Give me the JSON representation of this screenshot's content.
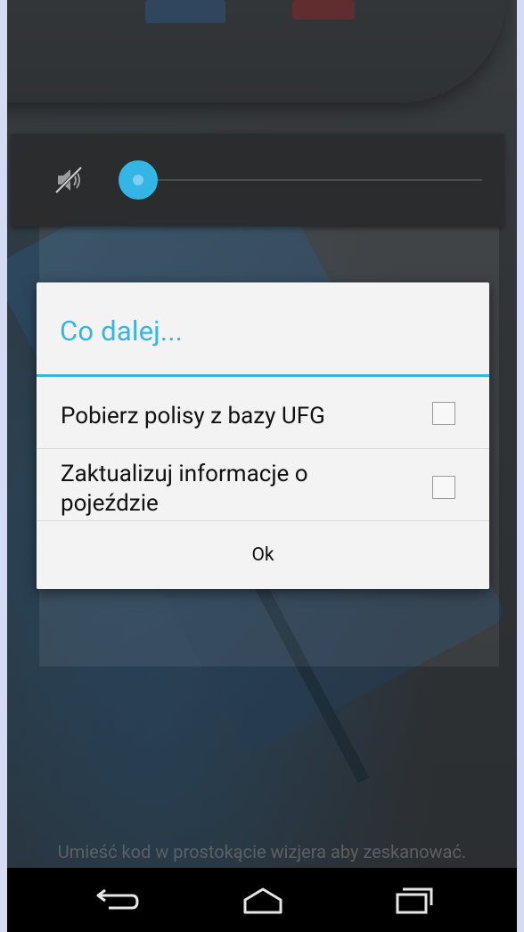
{
  "volume": {
    "mute_icon": "volume-mute-icon",
    "level": 0,
    "accent_color": "#33b5e5"
  },
  "dialog": {
    "title": "Co dalej...",
    "options": [
      {
        "label": "Pobierz polisy z bazy UFG",
        "checked": false
      },
      {
        "label": "Zaktualizuj informacje o pojeździe",
        "checked": false
      }
    ],
    "ok_label": "Ok"
  },
  "scanner": {
    "hint": "Umieść kod w prostokącie wizjera aby zeskanować."
  },
  "navbar": {
    "back_icon": "back-icon",
    "home_icon": "home-icon",
    "recent_icon": "recent-apps-icon"
  }
}
